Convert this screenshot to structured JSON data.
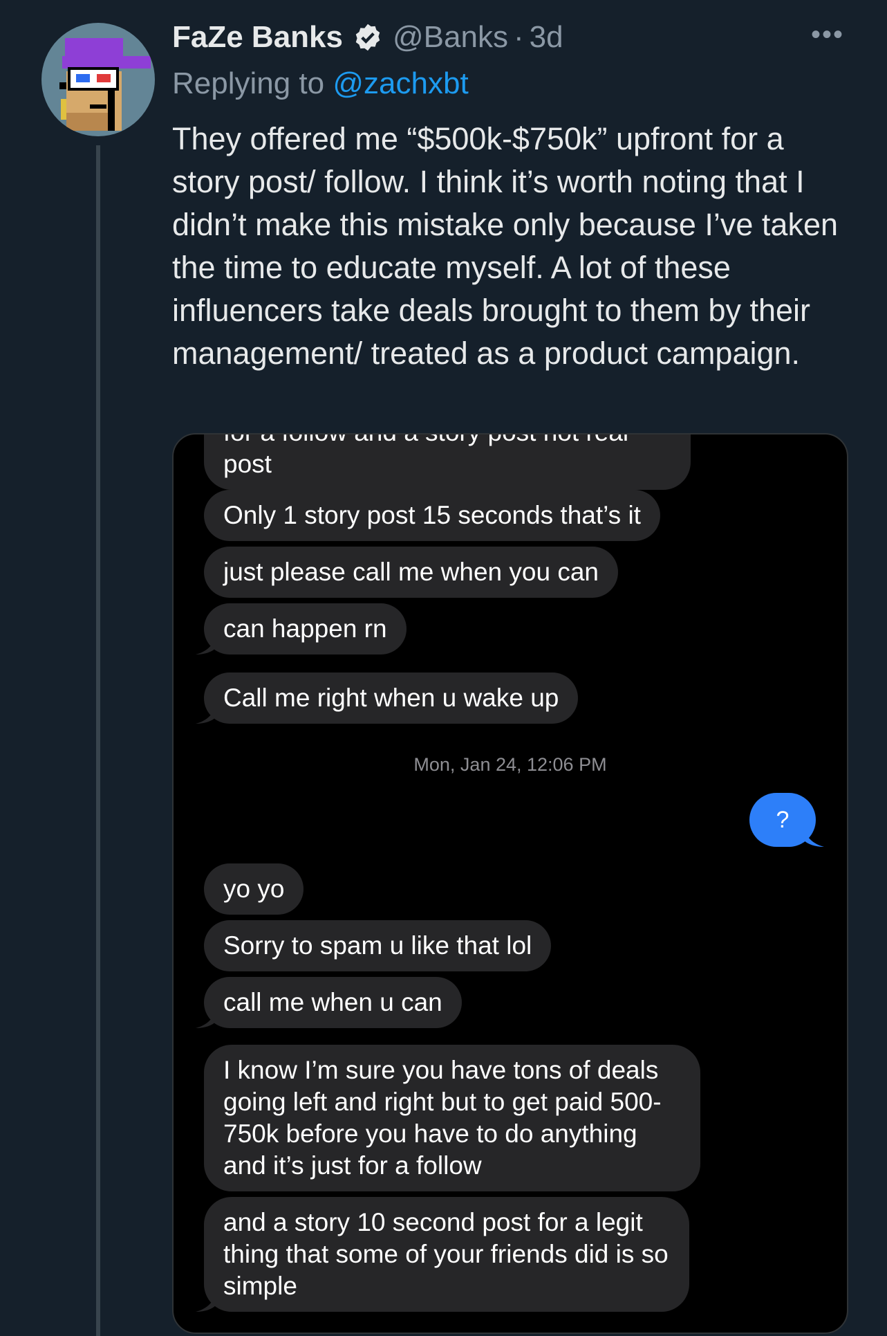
{
  "tweet": {
    "display_name": "FaZe Banks",
    "handle": "@Banks",
    "separator": "·",
    "time": "3d",
    "more": "•••",
    "replying_prefix": "Replying to ",
    "replying_to": "@zachxbt",
    "text": "They offered me “$500k-$750k” upfront for a story post/ follow. I think it’s worth noting that I didn’t make this mistake only because I’ve taken the time to educate myself. A lot of these influencers take deals brought to them by their management/ treated as a product campaign."
  },
  "messages": {
    "m1": "for a follow and a story post not real post",
    "m2": "Only 1 story post 15 seconds that’s it",
    "m3": "just please call me when you can",
    "m4": "can happen rn",
    "m5": "Call me right when u wake up",
    "timestamp": "Mon, Jan 24, 12:06 PM",
    "outgoing": "?",
    "m6": "yo yo",
    "m7": "Sorry to spam u like that lol",
    "m8": "call me when u can",
    "m9": "I know I’m sure you have tons of deals going left and right but to get paid 500-750k before you have to do anything and it’s just for a follow",
    "m10": "and a story 10 second post for a legit thing that some of your friends did is so simple"
  },
  "colors": {
    "background": "#15202b",
    "link": "#1d9bf0",
    "incoming_bubble": "#262628",
    "outgoing_bubble": "#2d7ff9"
  }
}
